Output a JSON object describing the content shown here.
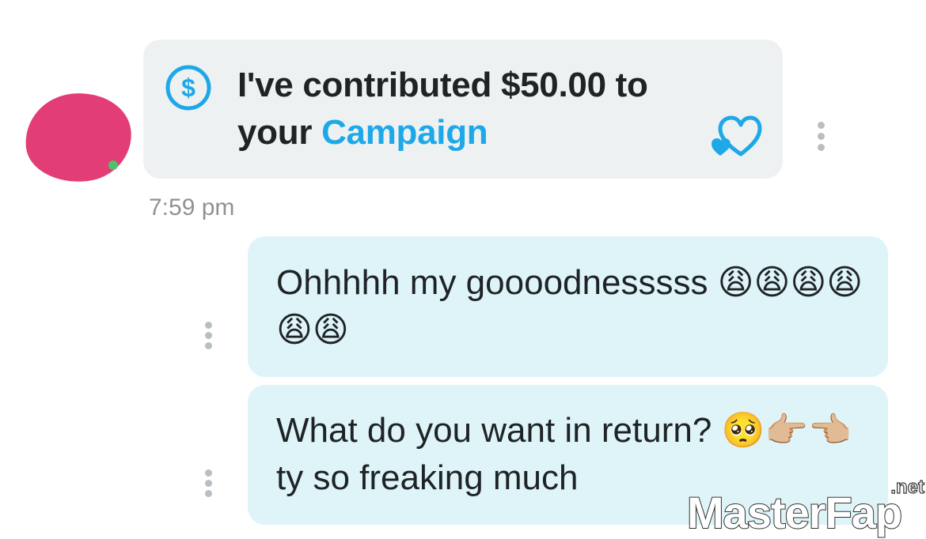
{
  "incoming": {
    "tip_text_prefix": "I've contributed $50.00 to your ",
    "tip_link": "Campaign",
    "timestamp": "7:59 pm",
    "icons": {
      "tip": "dollar-circle-icon",
      "like": "heart-outline-icon",
      "more": "more-vertical-icon"
    }
  },
  "outgoing": [
    {
      "text": "Ohhhhh my goooodnesssss 😩😩😩😩😩😩"
    },
    {
      "text": "What do you want in return? 🥺👉🏼👈🏼 ty so freaking much"
    }
  ],
  "watermark": {
    "main": "MasterFap",
    "suffix": ".net"
  },
  "colors": {
    "accent": "#1ea8e8",
    "incoming_bg": "#eef1f2",
    "outgoing_bg": "#def4f9",
    "avatar": "#e23d76"
  }
}
